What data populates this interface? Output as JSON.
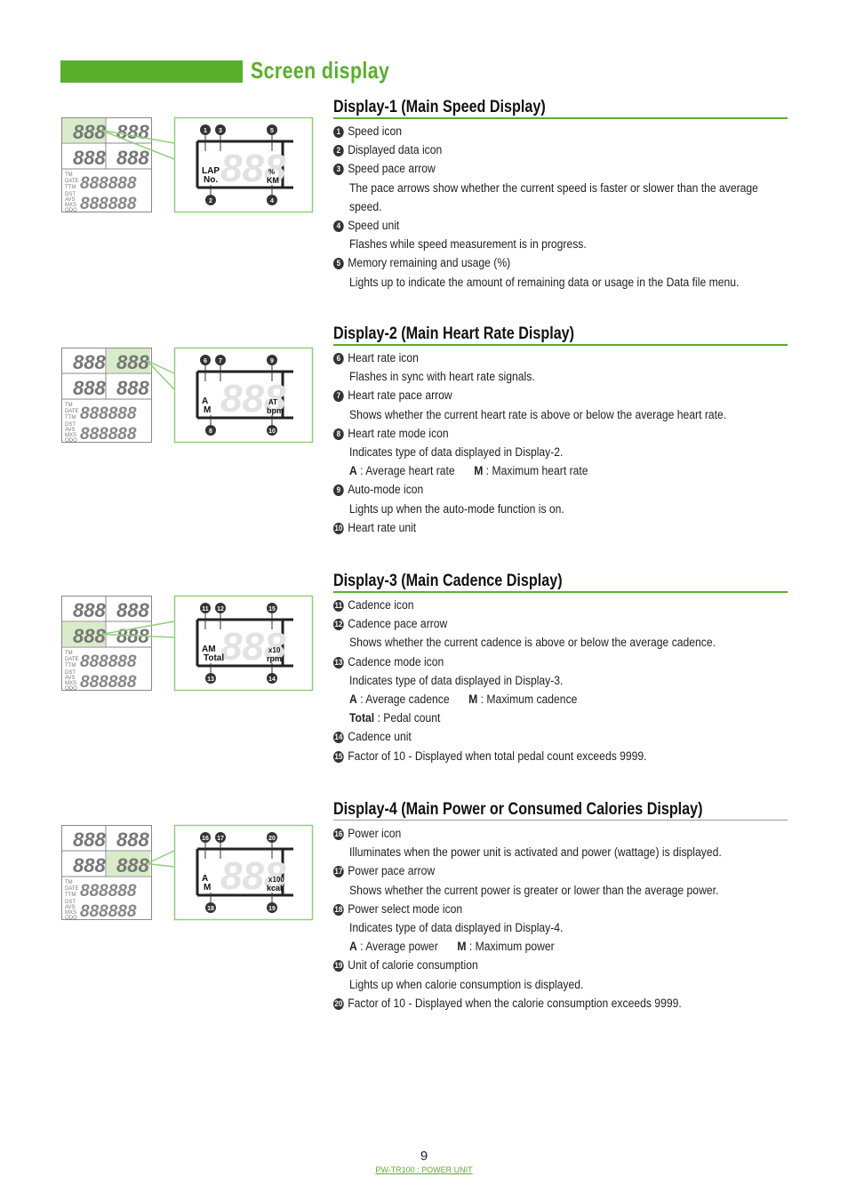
{
  "page_title": "Screen display",
  "accent_color": "#5aaf2a",
  "sections": [
    {
      "title": "Display-1 (Main Speed Display)",
      "highlight": "top-left",
      "diagram": {
        "labels": [
          "LAP",
          "No.",
          "%",
          "KM"
        ],
        "callouts_top": [
          "1",
          "3",
          "5"
        ],
        "callouts_bottom": [
          "2",
          "4"
        ]
      },
      "items": [
        {
          "num": "1",
          "label": "Speed icon",
          "lines": []
        },
        {
          "num": "2",
          "label": "Displayed data icon",
          "lines": []
        },
        {
          "num": "3",
          "label": "Speed pace arrow",
          "lines": [
            "The pace arrows show whether the current speed is faster or slower than the average",
            "speed."
          ]
        },
        {
          "num": "4",
          "label": "Speed unit",
          "lines": [
            "Flashes while speed measurement is in progress."
          ]
        },
        {
          "num": "5",
          "label": "Memory remaining and usage (%)",
          "lines": [
            "Lights up to indicate the amount of remaining data or usage in the Data file menu."
          ]
        }
      ]
    },
    {
      "title": "Display-2 (Main Heart Rate Display)",
      "highlight": "top-right",
      "diagram": {
        "labels": [
          "A",
          "M",
          "AT",
          "bpm"
        ],
        "callouts_top": [
          "6",
          "7",
          "9"
        ],
        "callouts_bottom": [
          "8",
          "10"
        ]
      },
      "items": [
        {
          "num": "6",
          "label": "Heart rate icon",
          "lines": [
            "Flashes in sync with heart rate signals."
          ]
        },
        {
          "num": "7",
          "label": "Heart rate pace arrow",
          "lines": [
            "Shows whether the current heart rate is above or below the average heart rate."
          ]
        },
        {
          "num": "8",
          "label": "Heart rate mode icon",
          "lines": [
            "Indicates type of data displayed in Display-2.",
            [
              [
                "A",
                " : Average heart rate"
              ],
              [
                "M",
                " : Maximum heart rate"
              ]
            ]
          ]
        },
        {
          "num": "9",
          "label": "Auto-mode icon",
          "lines": [
            "Lights up when the auto-mode function is on."
          ]
        },
        {
          "num": "10",
          "label": "Heart rate unit",
          "lines": []
        }
      ]
    },
    {
      "title": "Display-3 (Main Cadence Display)",
      "highlight": "mid-left",
      "diagram": {
        "labels": [
          "AM",
          "Total",
          "x10",
          "rpm"
        ],
        "callouts_top": [
          "11",
          "12",
          "15"
        ],
        "callouts_bottom": [
          "13",
          "14"
        ]
      },
      "items": [
        {
          "num": "11",
          "label": "Cadence icon",
          "lines": []
        },
        {
          "num": "12",
          "label": "Cadence pace arrow",
          "lines": [
            "Shows whether the current cadence is above or below the average cadence."
          ]
        },
        {
          "num": "13",
          "label": "Cadence mode icon",
          "lines": [
            "Indicates type of data displayed in Display-3.",
            [
              [
                "A",
                " : Average cadence"
              ],
              [
                "M",
                " : Maximum cadence"
              ]
            ],
            [
              [
                "Total",
                " : Pedal count"
              ]
            ]
          ]
        },
        {
          "num": "14",
          "label": "Cadence unit",
          "lines": []
        },
        {
          "num": "15",
          "label": "Factor of 10 - Displayed when total pedal count exceeds 9999.",
          "lines": []
        }
      ]
    },
    {
      "title": "Display-4 (Main Power or Consumed Calories Display)",
      "highlight": "mid-right",
      "diagram": {
        "labels": [
          "A",
          "M",
          "x100",
          "kcal"
        ],
        "callouts_top": [
          "16",
          "17",
          "20"
        ],
        "callouts_bottom": [
          "18",
          "19"
        ]
      },
      "items": [
        {
          "num": "16",
          "label": "Power icon",
          "lines": [
            "Illuminates when the power unit is activated and power (wattage) is displayed."
          ]
        },
        {
          "num": "17",
          "label": "Power pace arrow",
          "lines": [
            "Shows whether the current power is greater or lower than the average power."
          ]
        },
        {
          "num": "18",
          "label": "Power select mode icon",
          "lines": [
            "Indicates type of data displayed in Display-4.",
            [
              [
                "A",
                " : Average power"
              ],
              [
                "M",
                " : Maximum power"
              ]
            ]
          ]
        },
        {
          "num": "19",
          "label": "Unit of calorie consumption",
          "lines": [
            "Lights up when calorie consumption is displayed."
          ]
        },
        {
          "num": "20",
          "label": "Factor of 10 - Displayed when the calorie consumption exceeds 9999.",
          "lines": []
        }
      ]
    }
  ],
  "footer": {
    "page_number": "9",
    "product": "PW-TR100 : POWER UNIT"
  }
}
